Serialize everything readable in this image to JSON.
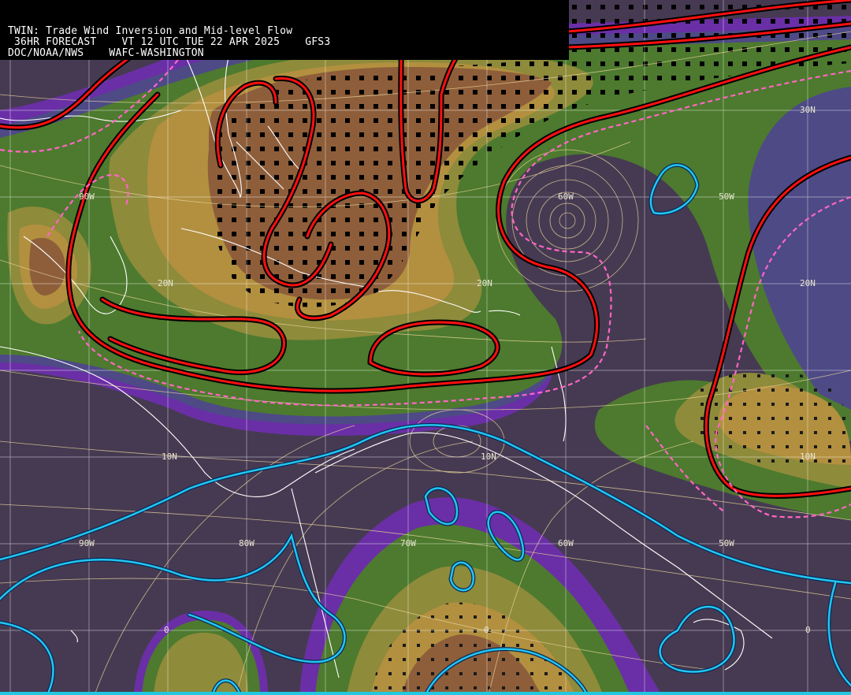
{
  "header": {
    "line1": "TWIN: Trade Wind Inversion and Mid-level Flow",
    "line2": " 36HR FORECAST    VT 12 UTC TUE 22 APR 2025    GFS3",
    "line3": "DOC/NOAA/NWS    WAFC-WASHINGTON"
  },
  "grid_labels": {
    "lat_30n_east": "30N",
    "lat_20n_west": "20N",
    "lat_20n_center": "20N",
    "lat_20n_east": "20N",
    "lat_10n_west": "10N",
    "lat_10n_center": "10N",
    "lat_10n_east": "10N",
    "lat_0_west": "0",
    "lat_0_center": "0",
    "lat_0_east": "0",
    "lon_90w_north": "90W",
    "lon_60w_north": "60W",
    "lon_50w_north": "50W",
    "lon_90w_south": "90W",
    "lon_80w_south": "80W",
    "lon_70w_south": "70W",
    "lon_60w_south": "60W",
    "lon_50w_south": "50W"
  },
  "colors": {
    "background_dark": "#463a52",
    "purple": "#6a2fa6",
    "slate_blue": "#4e4a86",
    "green": "#4d7a2e",
    "olive": "#8e8b3b",
    "tan": "#b2903f",
    "brown": "#8e5e3a",
    "red_contour": "#e01010",
    "pink_dashed": "#ff66c4",
    "cyan_contour": "#22b8f0",
    "streamline": "#e8d49a",
    "coastline": "#ffffff",
    "grid": "#ffffff"
  }
}
